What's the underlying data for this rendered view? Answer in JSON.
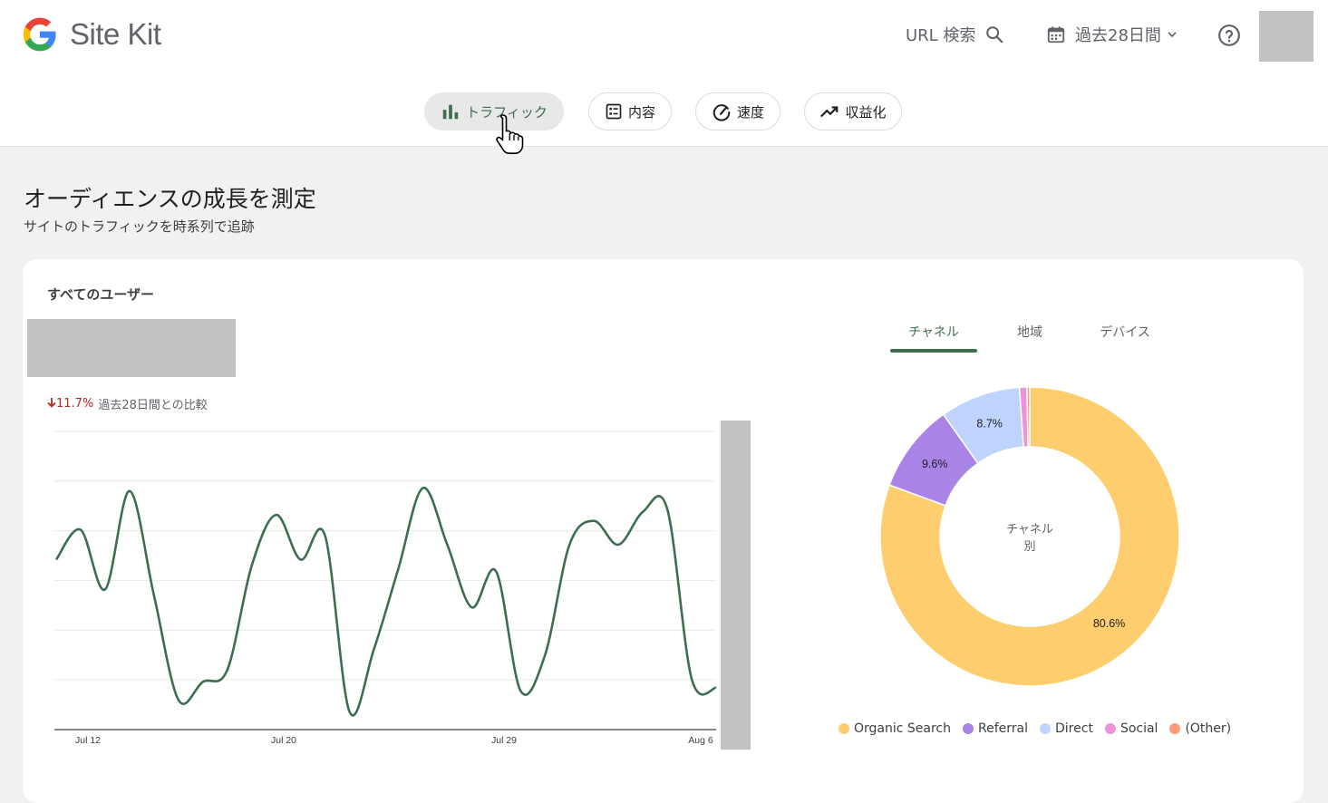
{
  "app": {
    "name": "Site Kit"
  },
  "header": {
    "url_search_label": "URL 検索",
    "date_range_label": "過去28日間",
    "help_icon": "help-circle-icon",
    "search_icon": "search-icon",
    "calendar_icon": "calendar-icon"
  },
  "nav": {
    "tabs": [
      {
        "label": "トラフィック",
        "icon": "bar-chart-icon",
        "active": true
      },
      {
        "label": "内容",
        "icon": "list-icon",
        "active": false
      },
      {
        "label": "速度",
        "icon": "speedometer-icon",
        "active": false
      },
      {
        "label": "収益化",
        "icon": "trending-up-icon",
        "active": false
      }
    ]
  },
  "section": {
    "title": "オーディエンスの成長を測定",
    "subtitle": "サイトのトラフィックを時系列で追跡"
  },
  "card": {
    "title": "すべてのユーザー",
    "change_value": "11.7%",
    "change_text": "過去28日間との比較",
    "change_color": "#b3261e",
    "dimension_tabs": [
      "チャネル",
      "地域",
      "デバイス"
    ],
    "active_dimension": "チャネル"
  },
  "chart_data": [
    {
      "type": "line",
      "series": [
        {
          "name": "",
          "color": "#3c6e4f",
          "values": [
            0.57,
            0.67,
            0.47,
            0.8,
            0.45,
            0.1,
            0.16,
            0.2,
            0.55,
            0.72,
            0.57,
            0.65,
            0.06,
            0.27,
            0.54,
            0.81,
            0.62,
            0.41,
            0.53,
            0.13,
            0.25,
            0.62,
            0.7,
            0.62,
            0.73,
            0.74,
            0.17,
            0.14
          ]
        }
      ],
      "x_tick_labels": [
        "Jul 12",
        "Jul 20",
        "Jul 29",
        "Aug 6"
      ],
      "grid": true
    },
    {
      "type": "pie",
      "center_label": "チャネル\n別",
      "slices": [
        {
          "label": "Organic Search",
          "value": 80.6,
          "display": "80.6%",
          "color": "#fdcd6e"
        },
        {
          "label": "Referral",
          "value": 9.6,
          "display": "9.6%",
          "color": "#a983e6"
        },
        {
          "label": "Direct",
          "value": 8.7,
          "display": "8.7%",
          "color": "#bed4ff"
        },
        {
          "label": "Social",
          "value": 0.8,
          "display": "",
          "color": "#ee92da"
        },
        {
          "label": "(Other)",
          "value": 0.3,
          "display": "",
          "color": "#ff9b7a"
        }
      ]
    }
  ]
}
